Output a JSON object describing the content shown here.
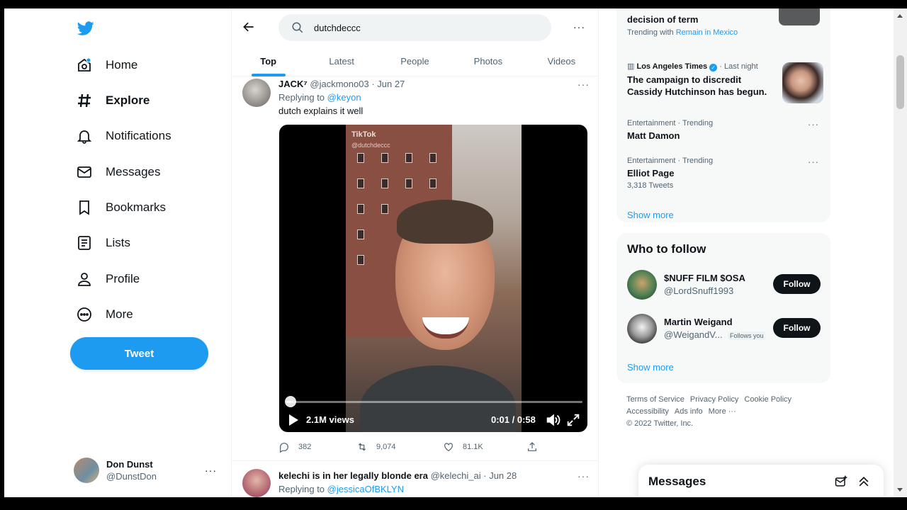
{
  "sidebar": {
    "items": [
      {
        "label": "Home",
        "icon": "home-icon"
      },
      {
        "label": "Explore",
        "icon": "hashtag-icon",
        "active": true
      },
      {
        "label": "Notifications",
        "icon": "bell-icon"
      },
      {
        "label": "Messages",
        "icon": "envelope-icon"
      },
      {
        "label": "Bookmarks",
        "icon": "bookmark-icon"
      },
      {
        "label": "Lists",
        "icon": "list-icon"
      },
      {
        "label": "Profile",
        "icon": "person-icon"
      },
      {
        "label": "More",
        "icon": "more-circle-icon"
      }
    ],
    "tweet_label": "Tweet",
    "account": {
      "name": "Don Dunst",
      "handle": "@DunstDon",
      "more": "···"
    }
  },
  "search": {
    "value": "dutchdeccc",
    "more": "···"
  },
  "tabs": [
    "Top",
    "Latest",
    "People",
    "Photos",
    "Videos"
  ],
  "tweets": [
    {
      "name": "JACK⁷",
      "handle": "@jackmono03",
      "date": "· Jun 27",
      "replying_prefix": "Replying to ",
      "replying_to": "@keyon",
      "text": "dutch explains it well",
      "video": {
        "watermark": "TikTok",
        "watermark_handle": "@dutchdeccc",
        "views": "2.1M views",
        "time": "0:01 / 0:58",
        "progress": 0.017
      },
      "replies": "382",
      "retweets": "9,074",
      "likes": "81.1K",
      "more": "···"
    },
    {
      "name": "kelechi is in her legally blonde era",
      "handle": "@kelechi_ai",
      "date": "· Jun 28",
      "replying_prefix": "Replying to ",
      "replying_to": "@jessicaOfBKLYN",
      "more": "···"
    }
  ],
  "trends": {
    "top_item": {
      "title": "decision of term",
      "meta_prefix": "Trending with ",
      "meta_link": "Remain in Mexico"
    },
    "news": {
      "source": "Los Angeles Times",
      "time": "· Last night",
      "title_line1": "The campaign to discredit",
      "title_line2": "Cassidy Hutchinson has begun."
    },
    "items": [
      {
        "meta": "Entertainment · Trending",
        "title": "Matt Damon",
        "count": ""
      },
      {
        "meta": "Entertainment · Trending",
        "title": "Elliot Page",
        "count": "3,318 Tweets"
      }
    ],
    "show_more": "Show more",
    "more": "···"
  },
  "who_to_follow": {
    "title": "Who to follow",
    "users": [
      {
        "name": "$NUFF FILM $OSA",
        "handle": "@LordSnuff1993",
        "badge": "",
        "button": "Follow"
      },
      {
        "name": "Martin Weigand",
        "handle": "@WeigandV...",
        "badge": "Follows you",
        "button": "Follow"
      }
    ],
    "show_more": "Show more"
  },
  "footer": {
    "links": [
      "Terms of Service",
      "Privacy Policy",
      "Cookie Policy",
      "Accessibility",
      "Ads info",
      "More ···"
    ],
    "copyright": "© 2022 Twitter, Inc."
  },
  "messages_drawer": {
    "title": "Messages"
  },
  "colors": {
    "accent": "#1d9bf0",
    "text": "#0f1419",
    "secondary": "#536471"
  }
}
